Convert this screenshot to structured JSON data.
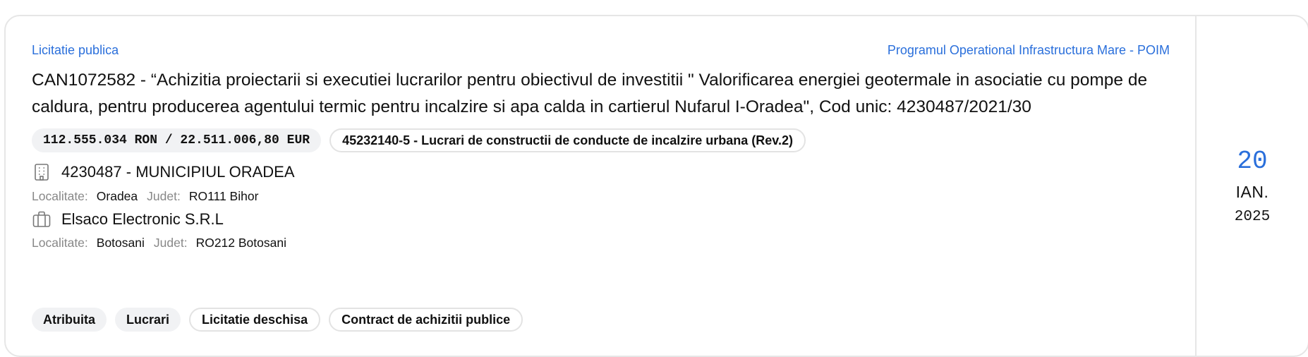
{
  "card": {
    "procedure_type": "Licitatie publica",
    "program": "Programul Operational Infrastructura Mare - POIM",
    "title": "CAN1072582 - “Achizitia proiectarii si executiei lucrarilor pentru obiectivul de investitii \" Valorificarea energiei geotermale in asociatie cu pompe de caldura, pentru producerea agentului termic pentru incalzire si apa calda in cartierul Nufarul I-Oradea\", Cod unic: 4230487/2021/30",
    "value_chip": "112.555.034 RON / 22.511.006,80 EUR",
    "cpv_chip": "45232140-5 - Lucrari de constructii de conducte de incalzire urbana (Rev.2)",
    "authority": {
      "icon": "building-icon",
      "name": "4230487 - MUNICIPIUL ORADEA",
      "localitate_label": "Localitate:",
      "localitate": "Oradea",
      "judet_label": "Judet:",
      "judet": "RO111 Bihor"
    },
    "supplier": {
      "icon": "briefcase-icon",
      "name": "Elsaco Electronic S.R.L",
      "localitate_label": "Localitate:",
      "localitate": "Botosani",
      "judet_label": "Judet:",
      "judet": "RO212 Botosani"
    },
    "tags": [
      {
        "label": "Atribuita",
        "style": "fill"
      },
      {
        "label": "Lucrari",
        "style": "fill"
      },
      {
        "label": "Licitatie deschisa",
        "style": "outline"
      },
      {
        "label": "Contract de achizitii publice",
        "style": "outline"
      }
    ],
    "date": {
      "day": "20",
      "month": "IAN.",
      "year": "2025"
    }
  },
  "colors": {
    "accent": "#2a6fdb",
    "border": "#e6e6e6",
    "chip_fill": "#f1f2f4",
    "muted": "#888888"
  }
}
